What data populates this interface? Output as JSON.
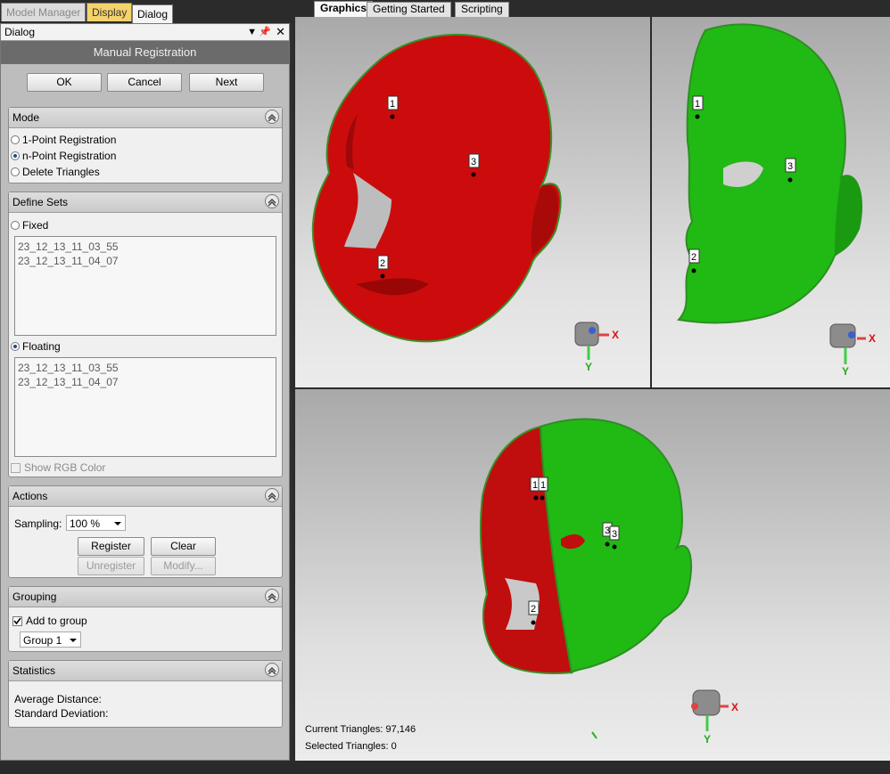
{
  "left_tabs": [
    "Model Manager",
    "Display",
    "Dialog"
  ],
  "dialog": {
    "title": "Dialog",
    "subtitle": "Manual Registration",
    "buttons": {
      "ok": "OK",
      "cancel": "Cancel",
      "next": "Next"
    }
  },
  "mode": {
    "title": "Mode",
    "options": [
      "1-Point Registration",
      "n-Point Registration",
      "Delete Triangles"
    ],
    "selected": "n-Point Registration"
  },
  "define_sets": {
    "title": "Define Sets",
    "fixed_label": "Fixed",
    "fixed_items": [
      "23_12_13_11_03_55",
      "23_12_13_11_04_07"
    ],
    "floating_label": "Floating",
    "floating_items": [
      "23_12_13_11_03_55",
      "23_12_13_11_04_07"
    ],
    "show_rgb": "Show RGB Color"
  },
  "actions": {
    "title": "Actions",
    "sampling_label": "Sampling:",
    "sampling_value": "100 %",
    "register": "Register",
    "clear": "Clear",
    "unregister": "Unregister",
    "modify": "Modify..."
  },
  "grouping": {
    "title": "Grouping",
    "add_to_group": "Add to group",
    "add_to_group_checked": true,
    "group_value": "Group 1"
  },
  "statistics": {
    "title": "Statistics",
    "avg": "Average Distance:",
    "std": "Standard Deviation:"
  },
  "graphics_tabs": [
    "Graphics",
    "Getting Started",
    "Scripting"
  ],
  "viewports": {
    "fixed_markers": [
      "1",
      "3",
      "2"
    ],
    "floating_markers": [
      "1",
      "3",
      "2"
    ],
    "combined_markers": [
      "1",
      "1",
      "3",
      "3",
      "2"
    ],
    "triad_labels": {
      "x": "X",
      "y": "Y"
    },
    "current_triangles": "Current Triangles: 97,146",
    "selected_triangles": "Selected Triangles: 0"
  },
  "colors": {
    "fixed_mesh": "#cc0000",
    "floating_mesh": "#22bb11",
    "highlight_tab": "#f5d36b"
  }
}
